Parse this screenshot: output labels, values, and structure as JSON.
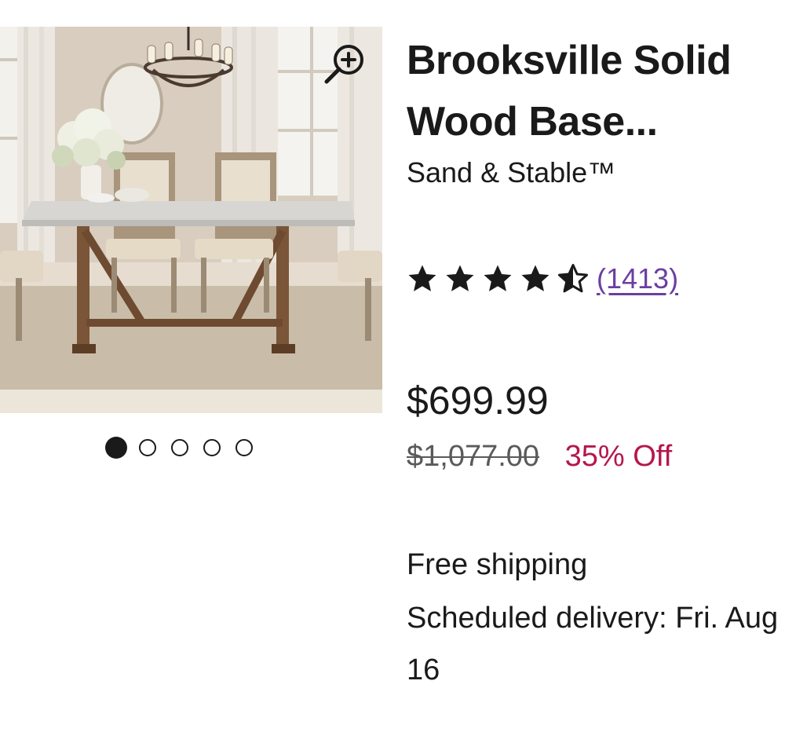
{
  "product": {
    "title": "Brooksville Solid Wood Base...",
    "brand": "Sand & Stable™",
    "rating": 4.5,
    "review_count": "(1413)",
    "price": "$699.99",
    "original_price": "$1,077.00",
    "discount": "35% Off",
    "shipping": "Free shipping",
    "delivery": "Scheduled delivery: Fri. Aug 16"
  },
  "gallery": {
    "image_count": 5,
    "active_index": 0,
    "zoom_icon": "zoom-in-icon"
  },
  "colors": {
    "text": "#1a1a1a",
    "review_link": "#6b3fa0",
    "discount": "#b5174d",
    "strikethrough": "#5a5a5a"
  }
}
